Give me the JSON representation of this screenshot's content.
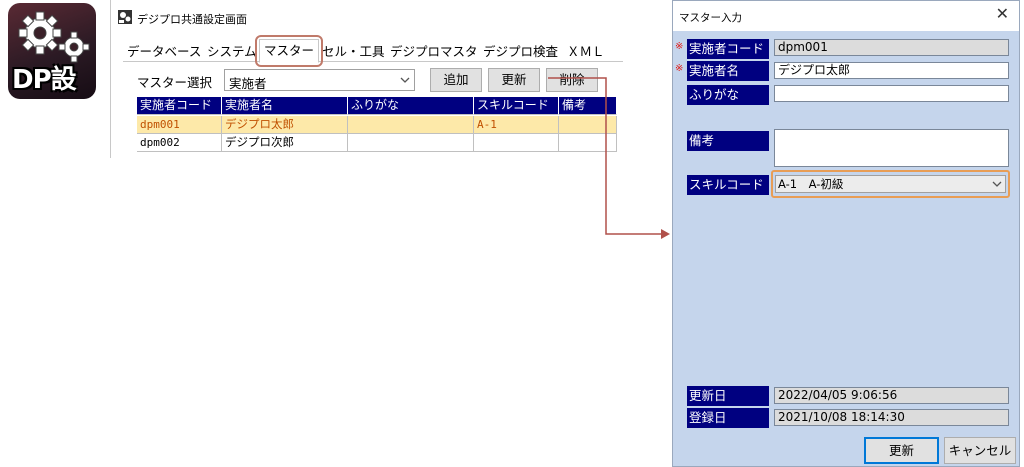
{
  "logo": {
    "text": "DP設定"
  },
  "main_window": {
    "title": "デジプロ共通設定画面",
    "tabs": [
      "データベース",
      "システム",
      "マスター",
      "セル・工具",
      "デジプロマスタ",
      "デジプロ検査",
      "ＸＭＬ"
    ],
    "active_tab": "マスター",
    "master_select_label": "マスター選択",
    "master_select_value": "実施者",
    "buttons": {
      "add": "追加",
      "update": "更新",
      "delete": "削除"
    },
    "grid": {
      "columns": [
        "実施者コード",
        "実施者名",
        "ふりがな",
        "スキルコード",
        "備考"
      ],
      "rows": [
        [
          "dpm001",
          "デジプロ太郎",
          "",
          "A-1",
          ""
        ],
        [
          "dpm002",
          "デジプロ次郎",
          "",
          "",
          ""
        ]
      ],
      "selected_row": 0
    }
  },
  "dialog": {
    "title": "マスター入力",
    "close_glyph": "✕",
    "required_mark": "※",
    "fields": {
      "code": {
        "label": "実施者コード",
        "value": "dpm001"
      },
      "name": {
        "label": "実施者名",
        "value": "デジプロ太郎"
      },
      "furigana": {
        "label": "ふりがな",
        "value": ""
      },
      "note": {
        "label": "備考",
        "value": ""
      },
      "skill": {
        "label": "スキルコード",
        "value": "A-1　A-初級"
      },
      "updated": {
        "label": "更新日",
        "value": "2022/04/05 9:06:56"
      },
      "registered": {
        "label": "登録日",
        "value": "2021/10/08 18:14:30"
      }
    },
    "buttons": {
      "ok": "更新",
      "cancel": "キャンセル"
    }
  },
  "colors": {
    "header_navy": "#000080",
    "dialog_bg": "#c5d5ec",
    "selected_row_bg": "#fde9a9",
    "selected_row_text": "#c05000",
    "required_red": "#e0201c",
    "highlight_orange": "#e89d55",
    "connector_red": "#b0504a"
  },
  "icons": [
    "gear-icon",
    "window-app-icon",
    "chevron-down-icon",
    "close-icon",
    "required-mark"
  ]
}
